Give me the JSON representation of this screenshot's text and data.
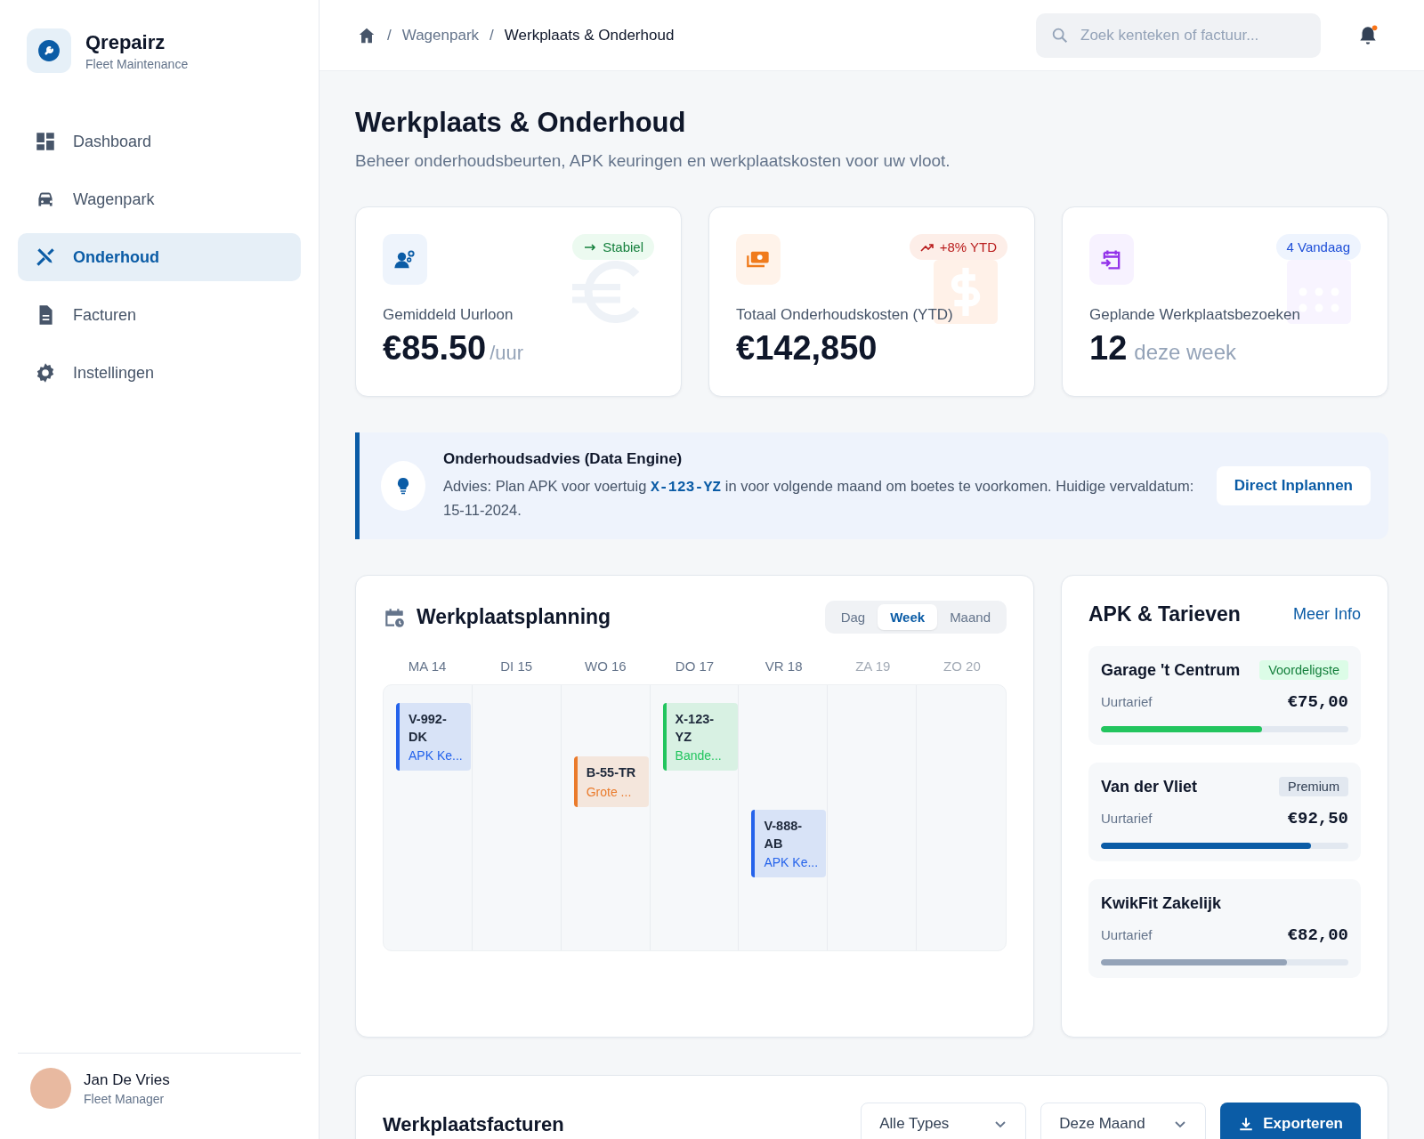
{
  "brand": {
    "name": "Qrepairz",
    "subtitle": "Fleet Maintenance"
  },
  "sidebar": {
    "items": [
      {
        "label": "Dashboard",
        "selected": false
      },
      {
        "label": "Wagenpark",
        "selected": false
      },
      {
        "label": "Onderhoud",
        "selected": true
      },
      {
        "label": "Facturen",
        "selected": false
      },
      {
        "label": "Instellingen",
        "selected": false
      }
    ]
  },
  "user": {
    "name": "Jan De Vries",
    "role": "Fleet Manager"
  },
  "breadcrumb": {
    "separator": "/",
    "items": [
      "Wagenpark",
      "Werkplaats & Onderhoud"
    ]
  },
  "search": {
    "placeholder": "Zoek kenteken of factuur..."
  },
  "notifications": {
    "unread": true
  },
  "page": {
    "title": "Werkplaats & Onderhoud",
    "subtitle": "Beheer onderhoudsbeurten, APK keuringen en werkplaatskosten voor uw vloot."
  },
  "stats": [
    {
      "kind": "steady",
      "badge": "Stabiel",
      "label": "Gemiddeld Uurloon",
      "value": "€85.50",
      "unit": "/uur"
    },
    {
      "kind": "rising",
      "badge": "+8% YTD",
      "label": "Totaal Onderhoudskosten (YTD)",
      "value": "€142,850"
    },
    {
      "kind": "info",
      "badge": "4 Vandaag",
      "label": "Geplande Werkplaatsbezoeken",
      "value": "12",
      "unit": "deze week"
    }
  ],
  "advice": {
    "title": "Onderhoudsadvies (Data Engine)",
    "text": "Advies: Plan APK voor voertuig **X-123-YZ** in voor volgende maand om boetes te voorkomen. Huidige vervaldatum: 15-11-2024.",
    "button": "Direct Inplannen"
  },
  "planning": {
    "title": "Werkplaatsplanning",
    "tabs": [
      {
        "label": "Dag",
        "selected": false
      },
      {
        "label": "Week",
        "selected": true
      },
      {
        "label": "Maand",
        "selected": false
      }
    ],
    "days": [
      {
        "label": "MA 14",
        "weekend": false,
        "events": [
          {
            "plate": "V-992-DK",
            "task": "APK Ke...",
            "color": "#2563eb"
          }
        ]
      },
      {
        "label": "DI 15",
        "weekend": false
      },
      {
        "label": "WO 16",
        "weekend": false,
        "events": [
          {
            "plate": "B-55-TR",
            "task": "Grote ...",
            "color": "#ea7b2c"
          }
        ]
      },
      {
        "label": "DO 17",
        "weekend": false,
        "events": [
          {
            "plate": "X-123-YZ",
            "task": "Bande...",
            "color": "#22c55e"
          }
        ]
      },
      {
        "label": "VR 18",
        "weekend": false,
        "events": [
          {
            "plate": "V-888-AB",
            "task": "APK Ke...",
            "color": "#2563eb"
          }
        ]
      },
      {
        "label": "ZA 19",
        "weekend": true
      },
      {
        "label": "ZO 20",
        "weekend": true
      }
    ]
  },
  "rates": {
    "title": "APK & Tarieven",
    "link": "Meer Info",
    "garages": [
      {
        "name": "Garage 't Centrum",
        "badge": "Voordeligste",
        "kind": "best",
        "rate_label": "Uurtarief",
        "price": "€75,00",
        "level": 0.65,
        "color": "#22c55e"
      },
      {
        "name": "Van der Vliet",
        "badge": "Premium",
        "kind": "premium",
        "rate_label": "Uurtarief",
        "price": "€92,50",
        "level": 0.85,
        "color": "#0b5ca6"
      },
      {
        "name": "KwikFit Zakelijk",
        "rate_label": "Uurtarief",
        "price": "€82,00",
        "level": 0.75,
        "color": "#94a3b8"
      }
    ]
  },
  "invoices": {
    "title": "Werkplaatsfacturen",
    "filters": [
      "Alle Types",
      "Deze Maand"
    ],
    "button": "Exporteren"
  }
}
